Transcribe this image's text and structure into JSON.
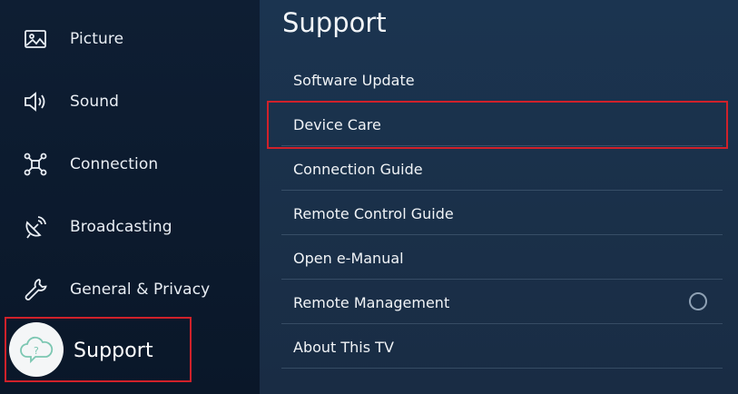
{
  "sidebar": {
    "items": [
      {
        "label": "Picture",
        "icon": "picture-icon"
      },
      {
        "label": "Sound",
        "icon": "speaker-icon"
      },
      {
        "label": "Connection",
        "icon": "network-icon"
      },
      {
        "label": "Broadcasting",
        "icon": "satellite-dish-icon"
      },
      {
        "label": "General & Privacy",
        "icon": "wrench-icon"
      },
      {
        "label": "Support",
        "icon": "cloud-question-icon",
        "selected": true
      }
    ]
  },
  "main": {
    "title": "Support",
    "items": [
      {
        "label": "Software Update"
      },
      {
        "label": "Device Care",
        "highlighted": true
      },
      {
        "label": "Connection Guide"
      },
      {
        "label": "Remote Control Guide"
      },
      {
        "label": "Open e-Manual"
      },
      {
        "label": "Remote Management",
        "toggle": "off"
      },
      {
        "label": "About This TV"
      }
    ]
  },
  "colors": {
    "highlight": "#d0212a",
    "panel": "#1a3049",
    "sidebar": "#0e1e33"
  }
}
